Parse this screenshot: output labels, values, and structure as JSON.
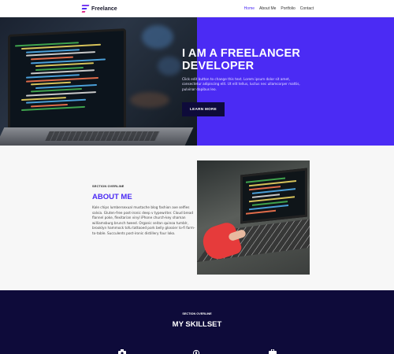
{
  "header": {
    "logo_text": "Freelance",
    "nav": [
      {
        "label": "Home",
        "active": true
      },
      {
        "label": "About Me",
        "active": false
      },
      {
        "label": "Portfolio",
        "active": false
      },
      {
        "label": "Contact",
        "active": false
      }
    ]
  },
  "hero": {
    "title_line1": "I AM A FREELANCER",
    "title_line2": "DEVELOPER",
    "description": "Click edit button to change this text. Lorem ipsum dolor sit amet, consectetur adipiscing elit. Ut elit tellus, luctus nec ullamcorper mattis, pulvinar dapibus leo.",
    "button_label": "LEARN MORE"
  },
  "about": {
    "overline": "SECTION OVERLINE",
    "title": "ABOUT ME",
    "body": "Kale chips lumbersexual mustache blog fashion axe selfies salvia. Gluten-free post-ironic deep v typewriter. Cloud bread flannel poke, flexitarian vinyl iPhone church-key shaman williamsburg brunch tweed. Organic seitan quinoa tumblr, brooklyn hammock tofu tattooed pork belly glossier lo-fi farm-to-table. Succulents post-ironic distillery four loko."
  },
  "skills": {
    "overline": "SECTION OVERLINE",
    "title": "MY SKILLSET"
  },
  "colors": {
    "accent": "#4b2bf4",
    "dark_navy": "#0e0b3a",
    "light_bg": "#f7f7f7"
  },
  "icons": [
    "logo-icon",
    "camera-icon",
    "compass-icon",
    "briefcase-icon"
  ]
}
